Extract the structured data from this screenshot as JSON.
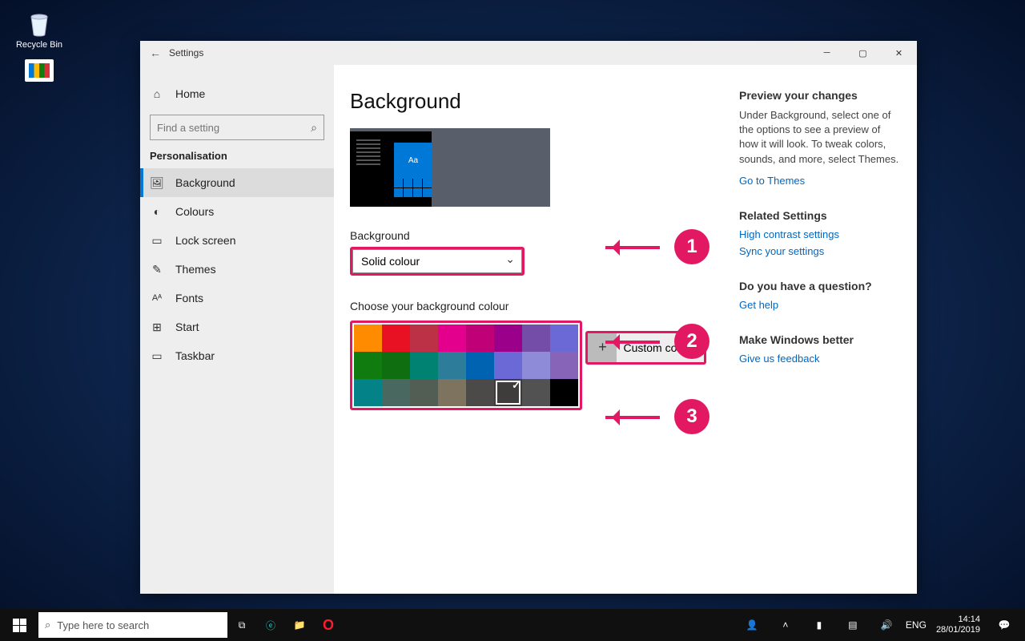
{
  "desktop": {
    "recycle_bin": "Recycle Bin"
  },
  "window": {
    "title": "Settings",
    "nav": {
      "home": "Home",
      "search_placeholder": "Find a setting",
      "category": "Personalisation",
      "items": [
        {
          "key": "background",
          "label": "Background",
          "active": true
        },
        {
          "key": "colours",
          "label": "Colours"
        },
        {
          "key": "lockscreen",
          "label": "Lock screen"
        },
        {
          "key": "themes",
          "label": "Themes"
        },
        {
          "key": "fonts",
          "label": "Fonts"
        },
        {
          "key": "start",
          "label": "Start"
        },
        {
          "key": "taskbar",
          "label": "Taskbar"
        }
      ]
    },
    "main": {
      "heading": "Background",
      "preview_sample": "Aa",
      "bg_label": "Background",
      "bg_value": "Solid colour",
      "palette_label": "Choose your background colour",
      "palette": [
        "#ff8c00",
        "#e81123",
        "#bc3146",
        "#e3008c",
        "#bf0077",
        "#9a0089",
        "#744da9",
        "#6b69d6",
        "#107c10",
        "#0f6e0f",
        "#008272",
        "#2d7d9a",
        "#0063b1",
        "#6b69d6",
        "#8e8cd8",
        "#8764b8",
        "#038387",
        "#486860",
        "#525e54",
        "#7e735f",
        "#4c4a48",
        "#3f3d3c",
        "#525252",
        "#000000"
      ],
      "selected_index": 21,
      "custom_label": "Custom colour"
    },
    "aside": {
      "preview_heading": "Preview your changes",
      "preview_text": "Under Background, select one of the options to see a preview of how it will look. To tweak colors, sounds, and more, select Themes.",
      "themes_link": "Go to Themes",
      "related_heading": "Related Settings",
      "high_contrast_link": "High contrast settings",
      "sync_link": "Sync your settings",
      "question_heading": "Do you have a question?",
      "help_link": "Get help",
      "better_heading": "Make Windows better",
      "feedback_link": "Give us feedback"
    }
  },
  "annotations": [
    "1",
    "2",
    "3"
  ],
  "taskbar": {
    "search_placeholder": "Type here to search",
    "lang": "ENG",
    "time": "14:14",
    "date": "28/01/2019"
  }
}
